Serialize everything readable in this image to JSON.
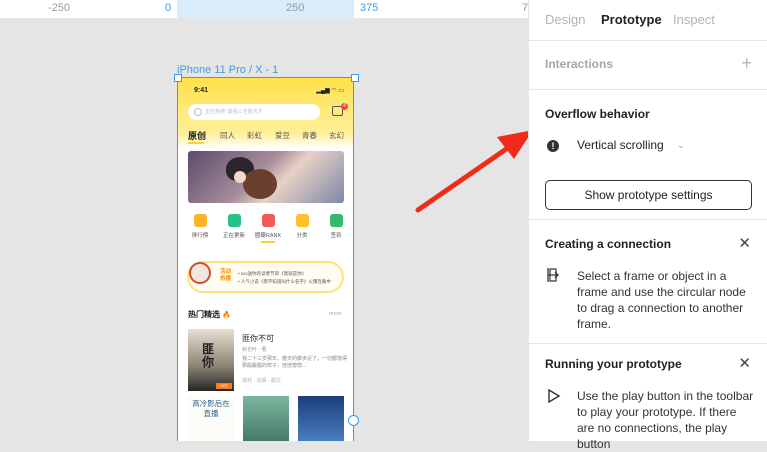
{
  "ruler": {
    "ticks": [
      "-250",
      "0",
      "250",
      "375",
      "7"
    ]
  },
  "frame": {
    "label": "iPhone 11 Pro / X - 1"
  },
  "app": {
    "status_time": "9:41",
    "status_icons": "▂▄▆ ◠ ▭",
    "search_placeholder": "正在热搜: 最强三全能天才",
    "msg_badge": "4",
    "tabs": [
      "原创",
      "同人",
      "彩虹",
      "爱豆",
      "青春",
      "玄幻"
    ],
    "nav_icons": [
      {
        "label": "排行榜",
        "color": "#ffb428"
      },
      {
        "label": "正在更新",
        "color": "#2bc088"
      },
      {
        "label": "圆瓣RANK",
        "color": "#f25a5a"
      },
      {
        "label": "分类",
        "color": "#ffc12a"
      },
      {
        "label": "签到",
        "color": "#34b86b"
      }
    ],
    "notice_badge": "活动热播",
    "notice_lines": [
      "• xxx送你的读者节目《我就是你》",
      "• 人气小说《南不知道叫什么名字》火爆连载中"
    ],
    "section_title": "热门精选",
    "section_more": "more",
    "book": {
      "cover_title": "匪你",
      "hot": "HOT",
      "title": "匪你不可",
      "author": "秋也叶 · 著",
      "desc": "我二十三岁那年，春天的脚步近了，一切都落得那般朦胧的样子，恍恍惚惚...",
      "tags": "现代 · 言情 · 甜文"
    },
    "grid_book_title": "高冷影后在直播"
  },
  "panel": {
    "tabs": [
      "Design",
      "Prototype",
      "Inspect"
    ],
    "interactions_label": "Interactions",
    "overflow_title": "Overflow behavior",
    "overflow_value": "Vertical scrolling",
    "settings_button": "Show prototype settings",
    "creating_title": "Creating a connection",
    "creating_text": "Select a frame or object in a frame and use the circular node to drag a connection to another frame.",
    "running_title": "Running your prototype",
    "running_text": "Use the play button in the toolbar to play your prototype. If there are no connections, the play button"
  },
  "colors": {
    "accent": "#3d9be9",
    "annotation": "#f12a1a",
    "app_yellow": "#ffe14a"
  }
}
